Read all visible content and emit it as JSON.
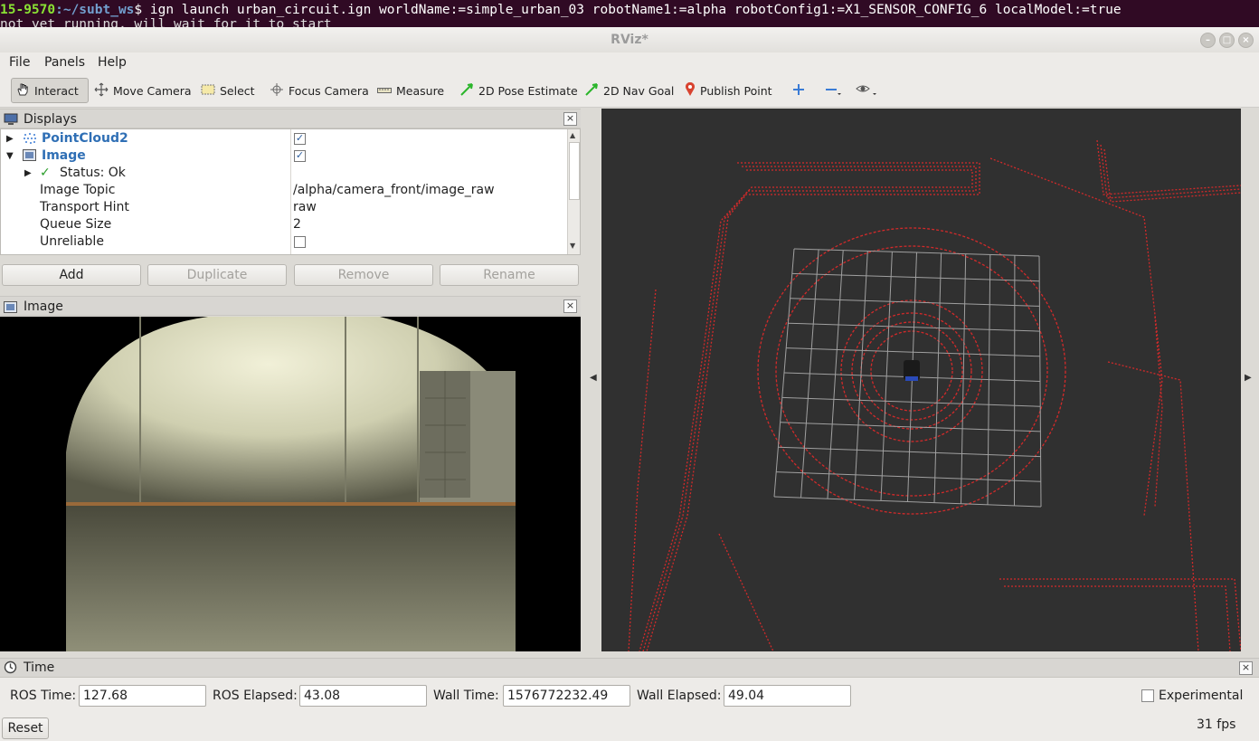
{
  "terminal": {
    "prompt_host": "15-9570",
    "prompt_path": ":~/subt_ws",
    "prompt_symbol": "$",
    "command": " ign launch urban_circuit.ign worldName:=simple_urban_03 robotName1:=alpha robotConfig1:=X1_SENSOR_CONFIG_6 localModel:=true",
    "line2": "not yet running, will wait for it to start"
  },
  "window": {
    "title": "RViz*"
  },
  "menu": {
    "file": "File",
    "panels": "Panels",
    "help": "Help"
  },
  "toolbar": {
    "interact": "Interact",
    "move_camera": "Move Camera",
    "select": "Select",
    "focus_camera": "Focus Camera",
    "measure": "Measure",
    "pose_estimate": "2D Pose Estimate",
    "nav_goal": "2D Nav Goal",
    "publish_point": "Publish Point"
  },
  "displays": {
    "title": "Displays",
    "pointcloud": "PointCloud2",
    "image": "Image",
    "status": "Status: Ok",
    "props": [
      {
        "key": "Image Topic",
        "value": "/alpha/camera_front/image_raw"
      },
      {
        "key": "Transport Hint",
        "value": "raw"
      },
      {
        "key": "Queue Size",
        "value": "2"
      },
      {
        "key": "Unreliable",
        "value": ""
      }
    ]
  },
  "buttons": {
    "add": "Add",
    "duplicate": "Duplicate",
    "remove": "Remove",
    "rename": "Rename"
  },
  "image_panel": {
    "title": "Image"
  },
  "time_panel": {
    "title": "Time",
    "ros_time_label": "ROS Time:",
    "ros_time": "127.68",
    "ros_elapsed_label": "ROS Elapsed:",
    "ros_elapsed": "43.08",
    "wall_time_label": "Wall Time:",
    "wall_time": "1576772232.49",
    "wall_elapsed_label": "Wall Elapsed:",
    "wall_elapsed": "49.04",
    "experimental": "Experimental",
    "reset": "Reset",
    "fps": "31 fps"
  },
  "colors": {
    "laser": "#d22a2a",
    "grid": "#a0a0a0",
    "view_bg": "#303030"
  }
}
